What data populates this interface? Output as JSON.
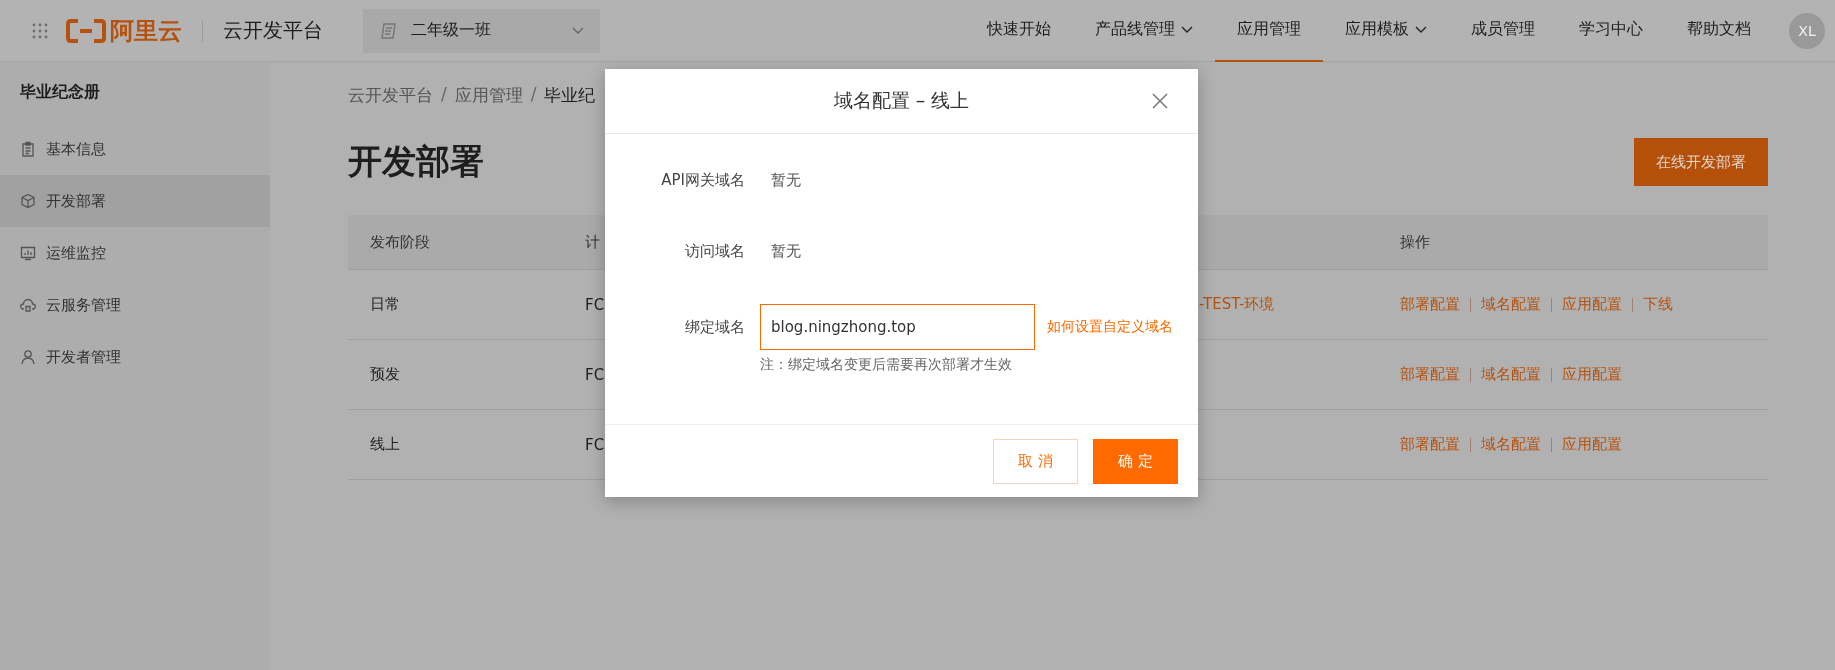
{
  "top_bar": {
    "logo_text": "阿里云",
    "product": "云开发平台",
    "project_select": {
      "value": "二年级一班"
    },
    "menu": [
      {
        "label": "快速开始",
        "selected": false,
        "dropdown": false
      },
      {
        "label": "产品线管理",
        "selected": false,
        "dropdown": true
      },
      {
        "label": "应用管理",
        "selected": true,
        "dropdown": false
      },
      {
        "label": "应用模板",
        "selected": false,
        "dropdown": true
      },
      {
        "label": "成员管理",
        "selected": false,
        "dropdown": false
      },
      {
        "label": "学习中心",
        "selected": false,
        "dropdown": false
      },
      {
        "label": "帮助文档",
        "selected": false,
        "dropdown": false
      }
    ],
    "avatar": "XL"
  },
  "sidebar": {
    "title": "毕业纪念册",
    "items": [
      {
        "label": "基本信息",
        "selected": false
      },
      {
        "label": "开发部署",
        "selected": true
      },
      {
        "label": "运维监控",
        "selected": false
      },
      {
        "label": "云服务管理",
        "selected": false
      },
      {
        "label": "开发者管理",
        "selected": false
      }
    ]
  },
  "breadcrumb": [
    {
      "kind": "link",
      "text": "云开发平台"
    },
    {
      "kind": "separator",
      "text": "/"
    },
    {
      "kind": "link",
      "text": "应用管理"
    },
    {
      "kind": "separator",
      "text": "/"
    },
    {
      "kind": "current",
      "text": "毕业纪"
    }
  ],
  "page_title": "开发部署",
  "primary_button": "在线开发部署",
  "table": {
    "headers": {
      "stage": "发布阶段",
      "column_2": "计",
      "actions": "操作"
    },
    "rows": [
      {
        "stage": "日常",
        "column_2": "FC",
        "column_3": "-TEST-环境",
        "actions": [
          "部署配置",
          "域名配置",
          "应用配置",
          "下线"
        ]
      },
      {
        "stage": "预发",
        "column_2": "FC",
        "actions": [
          "部署配置",
          "域名配置",
          "应用配置"
        ]
      },
      {
        "stage": "线上",
        "column_2": "FC",
        "actions": [
          "部署配置",
          "域名配置",
          "应用配置"
        ]
      }
    ]
  },
  "dialog": {
    "title": "域名配置 – 线上",
    "fields": [
      {
        "kind": "text",
        "label": "API网关域名",
        "value": "暂无"
      },
      {
        "kind": "text",
        "label": "访问域名",
        "value": "暂无"
      },
      {
        "kind": "input",
        "label": "绑定域名",
        "value": "blog.ningzhong.top",
        "link": "如何设置自定义域名",
        "note": "注：绑定域名变更后需要再次部署才生效"
      }
    ],
    "buttons": [
      {
        "kind": "secondary",
        "label": "取 消"
      },
      {
        "kind": "primary",
        "label": "确 定"
      }
    ]
  }
}
